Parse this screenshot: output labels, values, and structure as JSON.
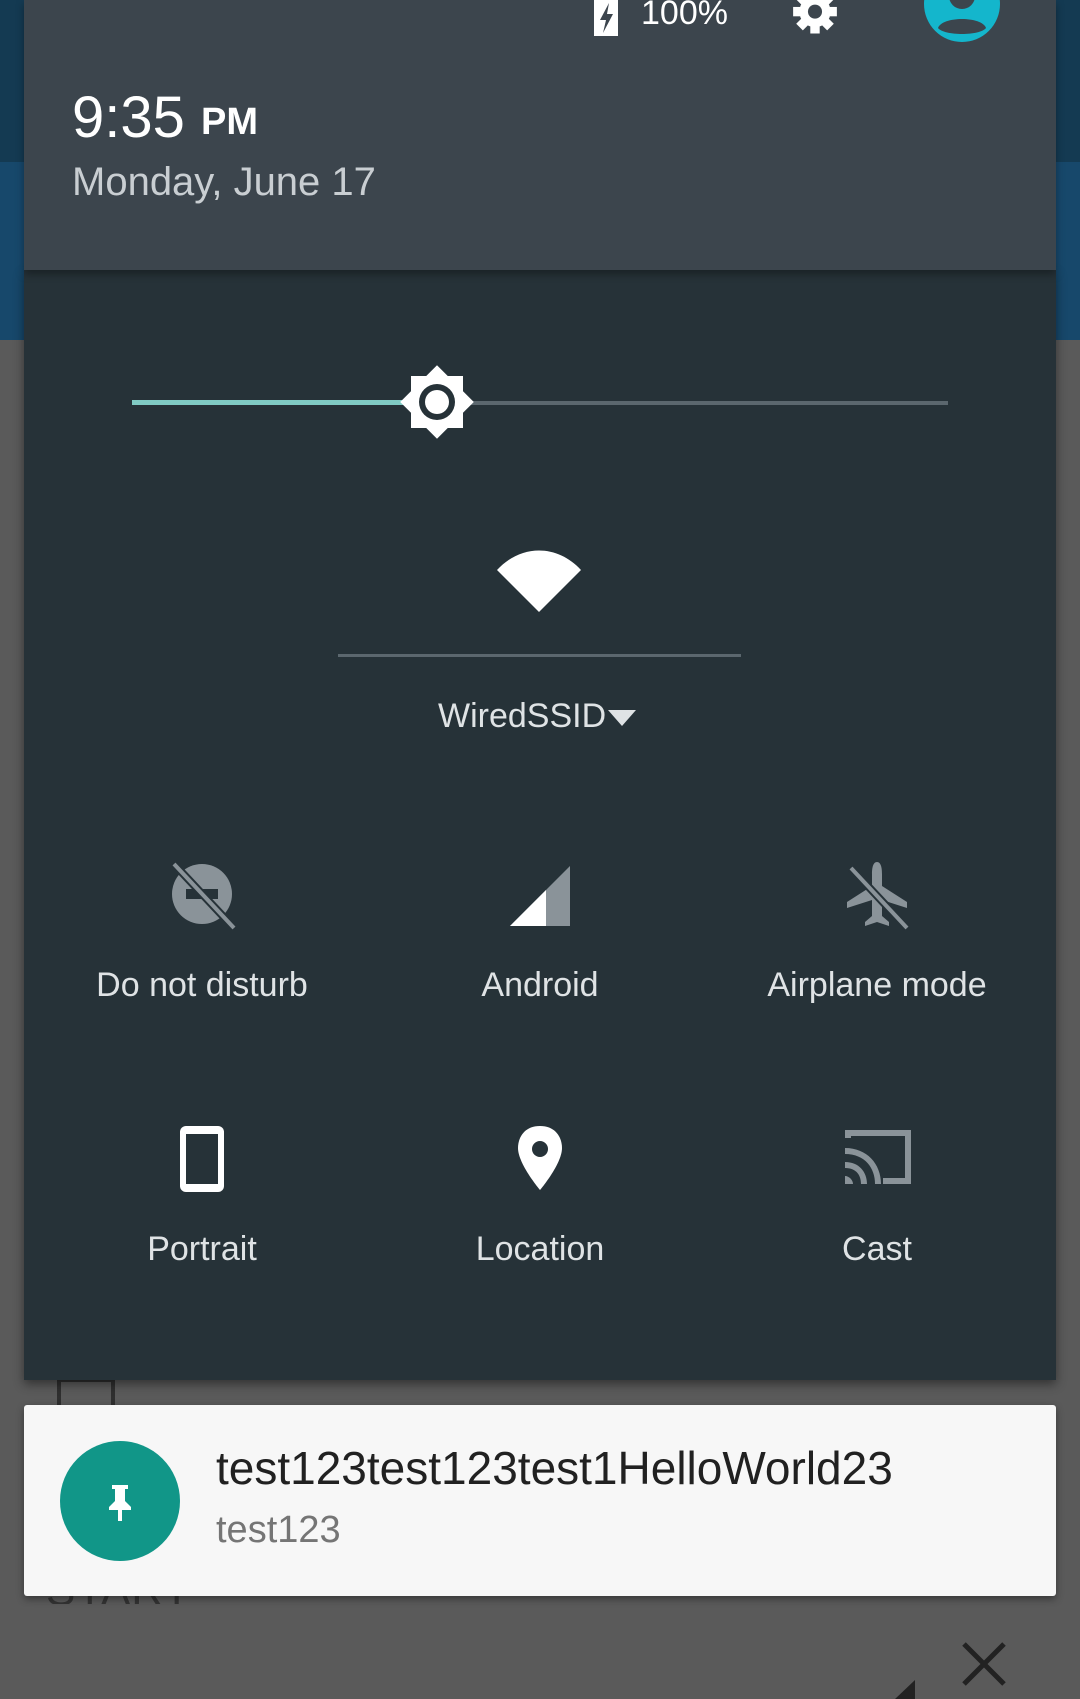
{
  "status_bar": {
    "battery_text": "100%",
    "battery_icon": "battery-charging-icon",
    "settings_icon": "gear-icon",
    "user_icon": "account-circle-icon"
  },
  "header": {
    "time": "9:35",
    "ampm": "PM",
    "date": "Monday, June 17"
  },
  "brightness": {
    "level": 0.36
  },
  "wifi": {
    "ssid": "WiredSSID",
    "icon": "wifi-icon",
    "dropdown_icon": "caret-down-icon"
  },
  "tiles": [
    {
      "label": "Do not disturb",
      "icon": "do-not-disturb-off-icon"
    },
    {
      "label": "Android",
      "icon": "cell-signal-icon"
    },
    {
      "label": "Airplane mode",
      "icon": "airplane-off-icon"
    },
    {
      "label": "Portrait",
      "icon": "phone-portrait-icon"
    },
    {
      "label": "Location",
      "icon": "location-pin-icon"
    },
    {
      "label": "Cast",
      "icon": "cast-icon"
    }
  ],
  "notification": {
    "title": "test123test123test1HelloWorld23",
    "text": "test123",
    "icon": "pin-icon"
  },
  "background_app": {
    "button_label": "START"
  },
  "colors": {
    "accent": "#80cbc4",
    "panel": "#263238",
    "header": "#3c454d",
    "notification_avatar": "#119688",
    "avatar": "#14b6cc"
  }
}
